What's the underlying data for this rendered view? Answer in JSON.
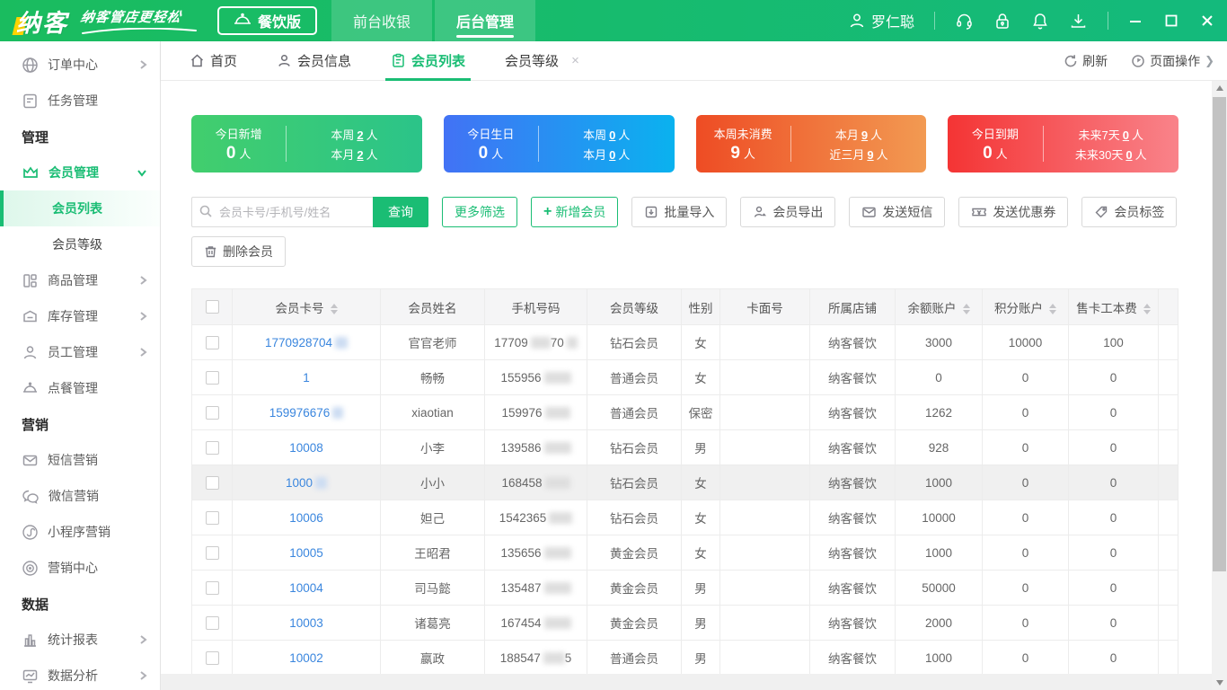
{
  "topbar": {
    "logo": "纳客",
    "slogan": "纳客管店更轻松",
    "edition": "餐饮版",
    "nav_front": "前台收银",
    "nav_back": "后台管理",
    "user": "罗仁聪"
  },
  "tabs": {
    "home": "首页",
    "member_info": "会员信息",
    "member_list": "会员列表",
    "member_level": "会员等级",
    "refresh": "刷新",
    "page_ops": "页面操作"
  },
  "sidebar": {
    "items": [
      {
        "label": "订单中心"
      },
      {
        "label": "任务管理"
      },
      {
        "label": "管理"
      },
      {
        "label": "会员管理"
      },
      {
        "label": "会员列表"
      },
      {
        "label": "会员等级"
      },
      {
        "label": "商品管理"
      },
      {
        "label": "库存管理"
      },
      {
        "label": "员工管理"
      },
      {
        "label": "点餐管理"
      },
      {
        "label": "营销"
      },
      {
        "label": "短信营销"
      },
      {
        "label": "微信营销"
      },
      {
        "label": "小程序营销"
      },
      {
        "label": "营销中心"
      },
      {
        "label": "数据"
      },
      {
        "label": "统计报表"
      },
      {
        "label": "数据分析"
      }
    ]
  },
  "stats": [
    {
      "title": "今日新增",
      "count": "0",
      "unit": "人",
      "items": [
        {
          "label": "本周",
          "value": "2",
          "unit": "人"
        },
        {
          "label": "本月",
          "value": "2",
          "unit": "人"
        }
      ]
    },
    {
      "title": "今日生日",
      "count": "0",
      "unit": "人",
      "items": [
        {
          "label": "本周",
          "value": "0",
          "unit": "人"
        },
        {
          "label": "本月",
          "value": "0",
          "unit": "人"
        }
      ]
    },
    {
      "title": "本周未消费",
      "count": "9",
      "unit": "人",
      "items": [
        {
          "label": "本月",
          "value": "9",
          "unit": "人"
        },
        {
          "label": "近三月",
          "value": "9",
          "unit": "人"
        }
      ]
    },
    {
      "title": "今日到期",
      "count": "0",
      "unit": "人",
      "items": [
        {
          "label": "未来7天",
          "value": "0",
          "unit": "人"
        },
        {
          "label": "未来30天",
          "value": "0",
          "unit": "人"
        }
      ]
    }
  ],
  "toolbar": {
    "search_placeholder": "会员卡号/手机号/姓名",
    "search": "查询",
    "more_filter": "更多筛选",
    "add_member": "新增会员",
    "batch_import": "批量导入",
    "member_export": "会员导出",
    "send_sms": "发送短信",
    "send_coupon": "发送优惠券",
    "member_tag": "会员标签",
    "delete_member": "删除会员"
  },
  "table": {
    "columns": [
      "会员卡号",
      "会员姓名",
      "手机号码",
      "会员等级",
      "性别",
      "卡面号",
      "所属店铺",
      "余额账户",
      "积分账户",
      "售卡工本费"
    ],
    "rows": [
      {
        "card": "1770928704",
        "name": "官官老师",
        "phone": "17709",
        "phone2": "70",
        "level": "钻石会员",
        "gender": "女",
        "face": "",
        "store": "纳客餐饮",
        "balance": "3000",
        "points": "10000",
        "fee": "100"
      },
      {
        "card": "1",
        "name": "畅畅",
        "phone": "155956",
        "phone2": "",
        "level": "普通会员",
        "gender": "女",
        "face": "",
        "store": "纳客餐饮",
        "balance": "0",
        "points": "0",
        "fee": "0"
      },
      {
        "card": "159976676",
        "name": "xiaotian",
        "phone": "159976",
        "phone2": "",
        "level": "普通会员",
        "gender": "保密",
        "face": "",
        "store": "纳客餐饮",
        "balance": "1262",
        "points": "0",
        "fee": "0"
      },
      {
        "card": "10008",
        "name": "小李",
        "phone": "139586",
        "phone2": "",
        "level": "钻石会员",
        "gender": "男",
        "face": "",
        "store": "纳客餐饮",
        "balance": "928",
        "points": "0",
        "fee": "0"
      },
      {
        "card": "1000",
        "name": "小小",
        "phone": "168458",
        "phone2": "",
        "level": "钻石会员",
        "gender": "女",
        "face": "",
        "store": "纳客餐饮",
        "balance": "1000",
        "points": "0",
        "fee": "0"
      },
      {
        "card": "10006",
        "name": "妲己",
        "phone": "1542365",
        "phone2": "",
        "level": "钻石会员",
        "gender": "女",
        "face": "",
        "store": "纳客餐饮",
        "balance": "10000",
        "points": "0",
        "fee": "0"
      },
      {
        "card": "10005",
        "name": "王昭君",
        "phone": "135656",
        "phone2": "",
        "level": "黄金会员",
        "gender": "女",
        "face": "",
        "store": "纳客餐饮",
        "balance": "1000",
        "points": "0",
        "fee": "0"
      },
      {
        "card": "10004",
        "name": "司马懿",
        "phone": "135487",
        "phone2": "",
        "level": "黄金会员",
        "gender": "男",
        "face": "",
        "store": "纳客餐饮",
        "balance": "50000",
        "points": "0",
        "fee": "0"
      },
      {
        "card": "10003",
        "name": "诸葛亮",
        "phone": "167454",
        "phone2": "",
        "level": "黄金会员",
        "gender": "男",
        "face": "",
        "store": "纳客餐饮",
        "balance": "2000",
        "points": "0",
        "fee": "0"
      },
      {
        "card": "10002",
        "name": "嬴政",
        "phone": "188547",
        "phone2": "5",
        "level": "普通会员",
        "gender": "男",
        "face": "",
        "store": "纳客餐饮",
        "balance": "1000",
        "points": "0",
        "fee": "0"
      }
    ]
  },
  "icons": {
    "plus": "+",
    "close": "×",
    "chevron": "❯"
  },
  "colors": {
    "brand_green": "#1abd74",
    "topbar": "#17ba70",
    "logo_accent": "#ffd400",
    "card_green": [
      "#42ce6d",
      "#2bc489"
    ],
    "card_blue": [
      "#4272f5",
      "#0ab2ef"
    ],
    "card_orange": [
      "#ee4c24",
      "#f29a52"
    ],
    "card_red": [
      "#f43434",
      "#f9838a"
    ],
    "link_blue": "#3a86de"
  }
}
